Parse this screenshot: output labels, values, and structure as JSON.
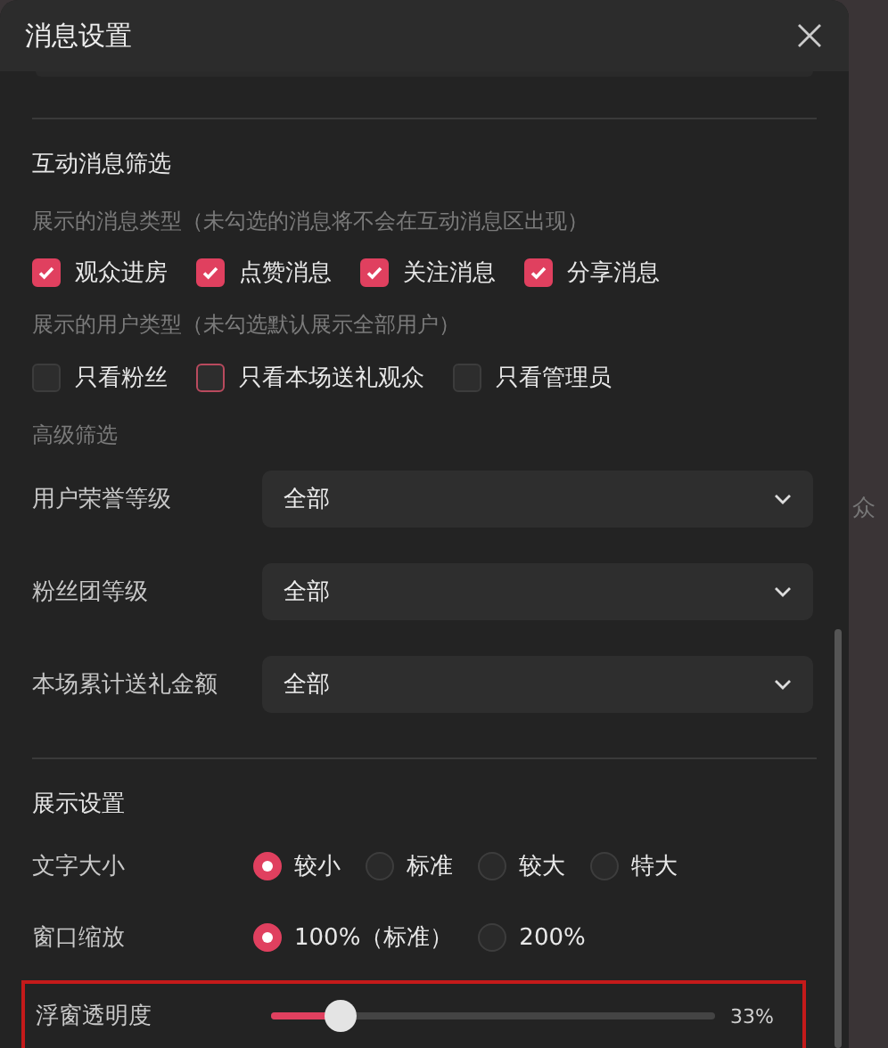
{
  "window": {
    "title": "消息设置"
  },
  "interaction_filter": {
    "heading": "互动消息筛选",
    "message_types": {
      "caption": "展示的消息类型（未勾选的消息将不会在互动消息区出现）",
      "options": [
        {
          "label": "观众进房",
          "checked": true
        },
        {
          "label": "点赞消息",
          "checked": true
        },
        {
          "label": "关注消息",
          "checked": true
        },
        {
          "label": "分享消息",
          "checked": true
        }
      ]
    },
    "user_types": {
      "caption": "展示的用户类型（未勾选默认展示全部用户）",
      "options": [
        {
          "label": "只看粉丝",
          "checked": false,
          "hovered": false
        },
        {
          "label": "只看本场送礼观众",
          "checked": false,
          "hovered": true
        },
        {
          "label": "只看管理员",
          "checked": false,
          "hovered": false
        }
      ]
    },
    "advanced": {
      "caption": "高级筛选",
      "selects": [
        {
          "label": "用户荣誉等级",
          "value": "全部"
        },
        {
          "label": "粉丝团等级",
          "value": "全部"
        },
        {
          "label": "本场累计送礼金额",
          "value": "全部"
        }
      ]
    }
  },
  "display": {
    "heading": "展示设置",
    "radio_groups": [
      {
        "label": "文字大小",
        "options": [
          {
            "label": "较小",
            "selected": true
          },
          {
            "label": "标准",
            "selected": false
          },
          {
            "label": "较大",
            "selected": false
          },
          {
            "label": "特大",
            "selected": false
          }
        ]
      },
      {
        "label": "窗口缩放",
        "options": [
          {
            "label": "100%（标准）",
            "selected": true
          },
          {
            "label": "200%",
            "selected": false
          }
        ]
      }
    ],
    "opacity": {
      "label": "浮窗透明度",
      "level": 0.16,
      "reading": "33%",
      "highlighted": true
    }
  },
  "background": {
    "text": "众"
  }
}
